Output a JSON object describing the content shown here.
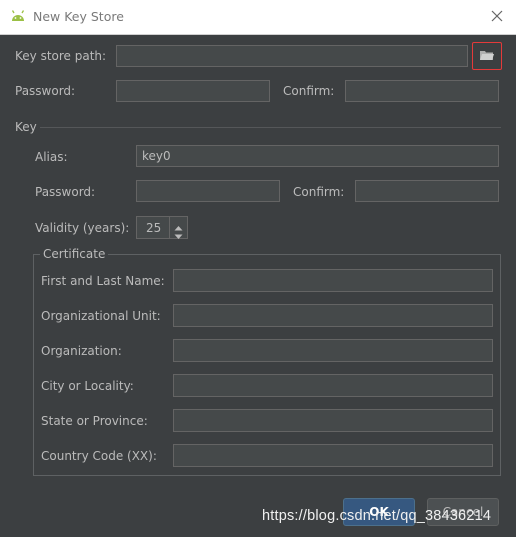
{
  "window": {
    "title": "New Key Store",
    "app_icon": "android-icon",
    "close_icon": "close-icon"
  },
  "keystore": {
    "path_label": "Key store path:",
    "path_value": "",
    "browse_icon": "folder-open-icon",
    "password_label": "Password:",
    "password_value": "",
    "confirm_label": "Confirm:",
    "confirm_value": ""
  },
  "key": {
    "section_label": "Key",
    "alias_label": "Alias:",
    "alias_value": "key0",
    "password_label": "Password:",
    "password_value": "",
    "confirm_label": "Confirm:",
    "confirm_value": "",
    "validity_label": "Validity (years):",
    "validity_value": "25"
  },
  "certificate": {
    "group_label": "Certificate",
    "fields": [
      {
        "label": "First and Last Name:",
        "value": ""
      },
      {
        "label": "Organizational Unit:",
        "value": ""
      },
      {
        "label": "Organization:",
        "value": ""
      },
      {
        "label": "City or Locality:",
        "value": ""
      },
      {
        "label": "State or Province:",
        "value": ""
      },
      {
        "label": "Country Code (XX):",
        "value": ""
      }
    ]
  },
  "footer": {
    "ok_label": "OK",
    "cancel_label": "Cancel"
  },
  "watermark": "https://blog.csdn.net/qq_38436214",
  "colors": {
    "background": "#3c3f41",
    "field": "#45494a",
    "ok_button": "#365880",
    "highlight_border": "#e53a3a"
  }
}
